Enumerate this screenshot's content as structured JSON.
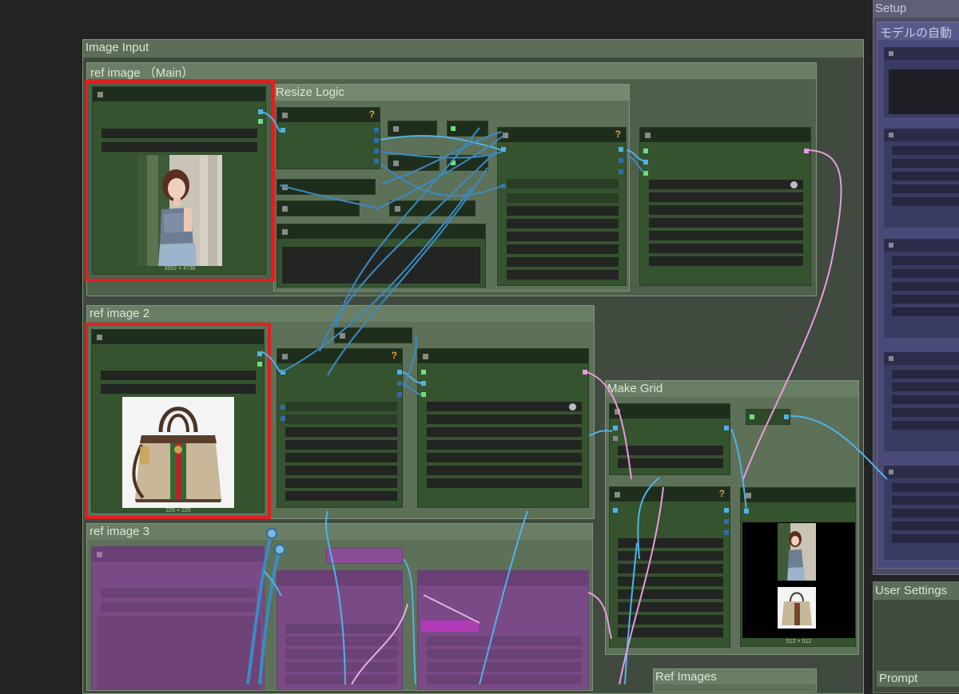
{
  "canvas": {
    "background_color": "#232323"
  },
  "groups": {
    "image_input": "Image Input",
    "ref_image_main": "ref image （Main）",
    "resize_logic": "Resize Logic",
    "ref_image_2": "ref image 2",
    "make_grid": "Make Grid",
    "ref_image_3": "ref image 3",
    "ref_images": "Ref Images",
    "setup": "Setup",
    "setup_sub": "モデルの自動",
    "user_settings": "User Settings",
    "prompt": "Prompt"
  },
  "images": {
    "main_dims": "3552 × 4736",
    "bag_dims": "225 × 225",
    "grid_dims": "512 × 512"
  },
  "markers": {
    "question": "?"
  },
  "icons": {
    "node_collapse": "square-dot-icon",
    "output_socket": "socket-icon"
  },
  "colors": {
    "node_green": "#35532f",
    "group_green": "#4f654b",
    "bypass_purple": "#7a4a86",
    "setup_blue": "#3a3b62",
    "highlight_red": "#e02020",
    "link_blue": "#4fb3e8",
    "link_pink": "#e79be0"
  }
}
